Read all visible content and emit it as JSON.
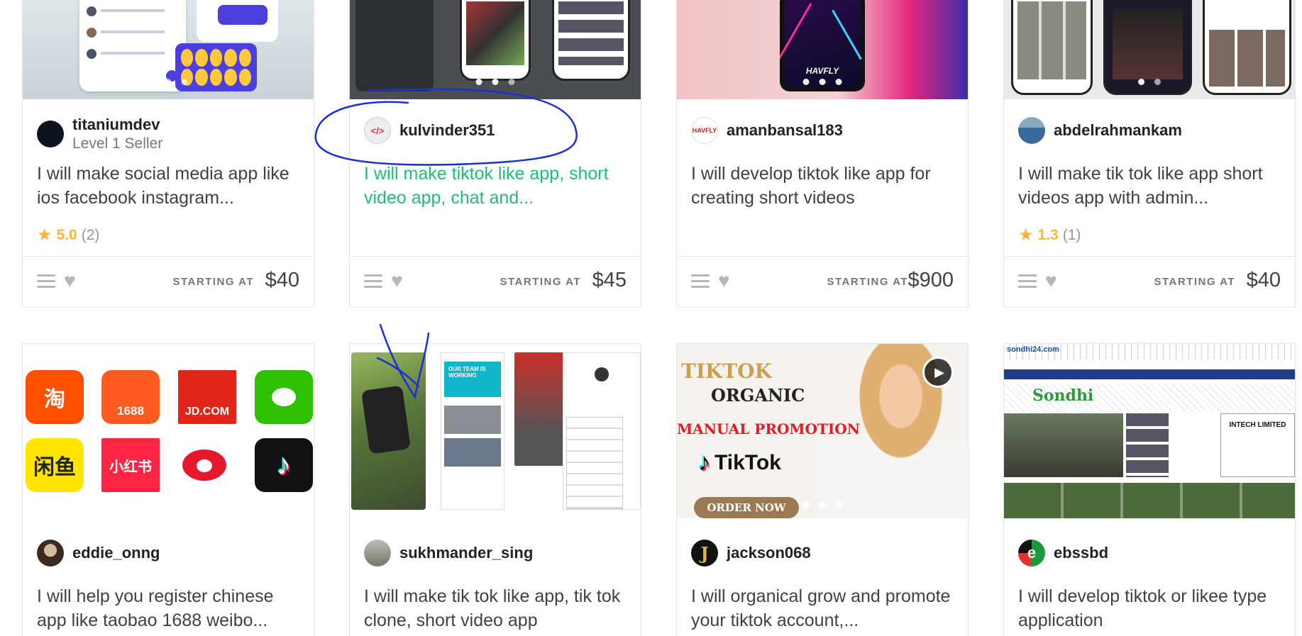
{
  "cards": [
    {
      "seller": "titaniumdev",
      "level": "Level 1 Seller",
      "title": "I will make social media app like ios facebook instagram...",
      "rating": "5.0",
      "reviews": "(2)",
      "starting": "STARTING AT",
      "price": "$40"
    },
    {
      "seller": "kulvinder351",
      "level": "",
      "title": "I will make tiktok like app, short video app, chat and...",
      "rating": "",
      "reviews": "",
      "starting": "STARTING AT",
      "price": "$45"
    },
    {
      "seller": "amanbansal183",
      "level": "",
      "title": "I will develop tiktok like app for creating short videos",
      "rating": "",
      "reviews": "",
      "starting": "STARTING AT",
      "price": "$900"
    },
    {
      "seller": "abdelrahmankam",
      "level": "",
      "title": "I will make tik tok like app short videos app with admin...",
      "rating": "1.3",
      "reviews": "(1)",
      "starting": "STARTING AT",
      "price": "$40"
    },
    {
      "seller": "eddie_onng",
      "level": "",
      "title": "I will help you register chinese app like taobao 1688 weibo..."
    },
    {
      "seller": "sukhmander_sing",
      "level": "",
      "title": "I will make tik tok like app, tik tok clone, short video app"
    },
    {
      "seller": "jackson068",
      "level": "",
      "title": "I will organical grow and promote your tiktok account,..."
    },
    {
      "seller": "ebssbd",
      "level": "",
      "title": "I will develop tiktok or likee type application"
    }
  ],
  "thumb_text": {
    "havfly": "HAVFLY",
    "app_icons": [
      "淘",
      "1688",
      "JD.COM",
      "",
      "闲鱼",
      "小红书",
      "",
      ""
    ],
    "promo_line1": "TIKTOK",
    "promo_line2": "ORGANIC",
    "promo_line3": "MANUAL PROMOTION",
    "promo_brand": "TikTok",
    "promo_cta": "ORDER NOW",
    "news_site": "sondhi24.com",
    "news_brand": "Sondhi",
    "news_ad": "INTECH LIMITED"
  },
  "colors": {
    "accent_green": "#1dbf73",
    "star": "#ffb33e",
    "annotation_blue": "#1a2fd6"
  }
}
